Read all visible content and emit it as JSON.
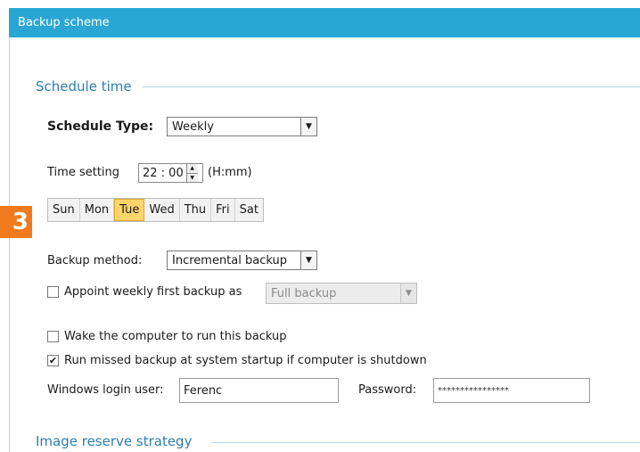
{
  "window": {
    "title": "Backup scheme"
  },
  "marker": {
    "text": "3"
  },
  "schedule": {
    "section_title": "Schedule time",
    "type_label": "Schedule Type:",
    "type_value": "Weekly",
    "time_label": "Time setting",
    "time_value": "22 : 00",
    "time_format": "(H:mm)",
    "days": [
      {
        "label": "Sun",
        "selected": false
      },
      {
        "label": "Mon",
        "selected": false
      },
      {
        "label": "Tue",
        "selected": true
      },
      {
        "label": "Wed",
        "selected": false
      },
      {
        "label": "Thu",
        "selected": false
      },
      {
        "label": "Fri",
        "selected": false
      },
      {
        "label": "Sat",
        "selected": false
      }
    ],
    "method_label": "Backup method:",
    "method_value": "Incremental backup",
    "appoint_label": "Appoint weekly first backup as",
    "appoint_checked": false,
    "appoint_value": "Full backup",
    "wake_label": "Wake the computer to run this backup",
    "wake_checked": false,
    "missed_label": "Run missed backup at system startup if computer is shutdown",
    "missed_checked": true,
    "login_label": "Windows login user:",
    "login_value": "Ferenc",
    "password_label": "Password:",
    "password_value": "****************"
  },
  "reserve": {
    "section_title": "Image reserve strategy"
  },
  "colors": {
    "titlebar": "#2aa6d4",
    "accent_text": "#2d7eb0",
    "selected_day": "#ffd46b",
    "marker": "#f07a1e"
  }
}
